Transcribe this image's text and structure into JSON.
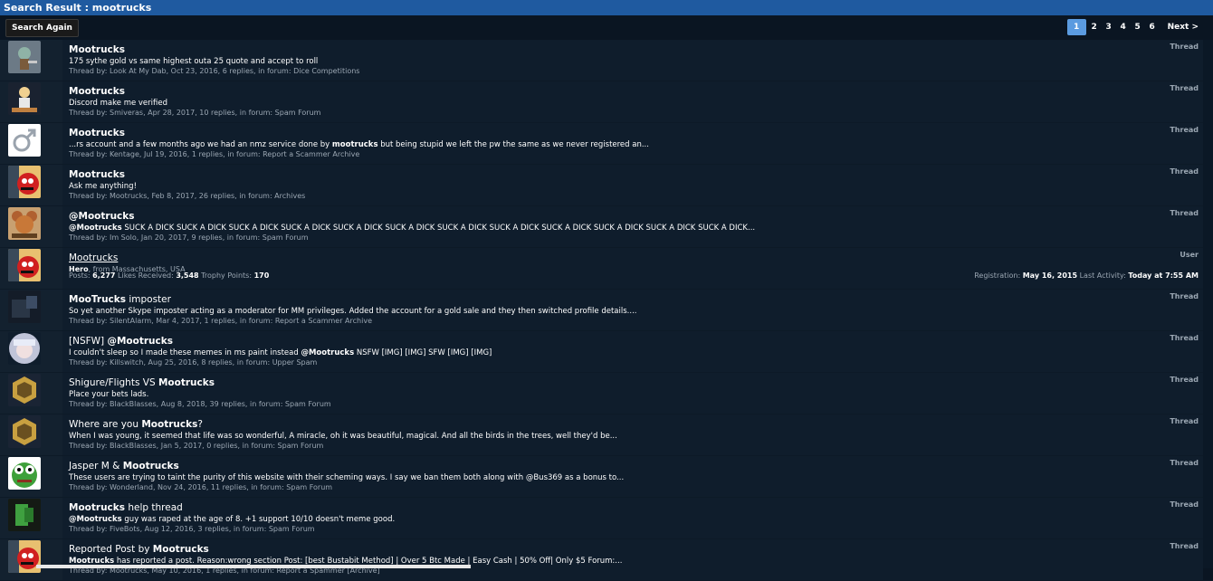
{
  "header": {
    "title": "Search Result : mootrucks"
  },
  "controls": {
    "search_again": "Search Again",
    "pages": [
      "1",
      "2",
      "3",
      "4",
      "5",
      "6"
    ],
    "next": "Next >"
  },
  "results": [
    {
      "avatar": "avatar-squidward-icon",
      "title": "Mootrucks",
      "title_bold": true,
      "snippet": "175 sythe gold vs same highest outa 25 quote and accept to roll",
      "meta": "Thread by: Look At My Dab, Oct 23, 2016, 6 replies, in forum: Dice Competitions",
      "type": "Thread"
    },
    {
      "avatar": "avatar-smiveras-icon",
      "title": "Mootrucks",
      "title_bold": true,
      "snippet": "Discord make me verified",
      "meta": "Thread by: Smiveras, Apr 28, 2017, 10 replies, in forum: Spam Forum",
      "type": "Thread"
    },
    {
      "avatar": "avatar-male-symbol-icon",
      "title": "Mootrucks",
      "title_bold": true,
      "snippet_pre": "...rs account and a few months ago we had an nmz service done by ",
      "snippet_bold": "mootrucks",
      "snippet_post": " but being stupid we left the pw the same as we never registered an...",
      "meta": "Thread by: Kentage, Jul 19, 2016, 1 replies, in forum: Report a Scammer Archive",
      "type": "Thread"
    },
    {
      "avatar": "avatar-red-cartoon-icon",
      "title": "Mootrucks",
      "title_bold": true,
      "snippet": "Ask me anything!",
      "meta": "Thread by: Mootrucks, Feb 8, 2017, 26 replies, in forum: Archives",
      "type": "Thread"
    },
    {
      "avatar": "avatar-jerry-icon",
      "title": "@Mootrucks",
      "title_bold": true,
      "snippet_bold": "@Mootrucks",
      "snippet_post": " SUCK A DICK SUCK A DICK SUCK A DICK SUCK A DICK SUCK A DICK SUCK A DICK SUCK A DICK SUCK A DICK SUCK A DICK SUCK A DICK SUCK A DICK SUCK A DICK...",
      "meta": "Thread by: Im Solo, Jan 20, 2017, 9 replies, in forum: Spam Forum",
      "type": "Thread"
    },
    {
      "user": true,
      "avatar": "avatar-red-cartoon-icon",
      "title": "Mootrucks",
      "rank": "Hero",
      "from": ", from Massachusetts, USA",
      "posts_label": "Posts: ",
      "posts": "6,277",
      "likes_label": " Likes Received: ",
      "likes": "3,548",
      "trophy_label": " Trophy Points: ",
      "trophy": "170",
      "reg_label": "Registration: ",
      "reg": "May 16, 2015",
      "act_label": " Last Activity: ",
      "act": "Today at 7:55 AM",
      "type": "User"
    },
    {
      "avatar": "avatar-dark-scene-icon",
      "title_bold_part": "MooTrucks",
      "title_rest": " imposter",
      "snippet": "So yet another Skype imposter acting as a moderator for MM privileges. Added the account for a gold sale and they then switched profile details....",
      "meta": "Thread by: SilentAlarm, Mar 4, 2017, 1 replies, in forum: Report a Scammer Archive",
      "type": "Thread"
    },
    {
      "avatar": "avatar-anime-icon",
      "title_pre": "[NSFW] ",
      "title_bold_part": "@Mootrucks",
      "snippet_pre": "I couldn't sleep so I made these memes in ms paint instead ",
      "snippet_bold": "@Mootrucks",
      "snippet_post": " NSFW [IMG] [IMG] SFW [IMG] [IMG]",
      "meta": "Thread by: Killswitch, Aug 25, 2016, 8 replies, in forum: Upper Spam",
      "type": "Thread"
    },
    {
      "avatar": "avatar-gold-badge-icon",
      "title_pre": "Shigure/Flights VS ",
      "title_bold_part": "Mootrucks",
      "snippet": "Place your bets lads.",
      "meta": "Thread by: BlackBlasses, Aug 8, 2018, 39 replies, in forum: Spam Forum",
      "type": "Thread"
    },
    {
      "avatar": "avatar-gold-badge-icon",
      "title_pre": "Where are you ",
      "title_bold_part": "Mootrucks",
      "title_rest": "?",
      "snippet": "When I was young, it seemed that life was so wonderful, A miracle, oh it was beautiful, magical. And all the birds in the trees, well they'd be...",
      "meta": "Thread by: BlackBlasses, Jan 5, 2017, 0 replies, in forum: Spam Forum",
      "type": "Thread"
    },
    {
      "avatar": "avatar-pepe-icon",
      "title_pre": "Jasper M & ",
      "title_bold_part": "Mootrucks",
      "snippet": "These users are trying to taint the purity of this website with their scheming ways. I say we ban them both along with @Bus369 as a bonus to...",
      "meta": "Thread by: Wonderland, Nov 24, 2016, 11 replies, in forum: Spam Forum",
      "type": "Thread"
    },
    {
      "avatar": "avatar-green-logo-icon",
      "title_bold_part": "Mootrucks",
      "title_rest": " help thread",
      "snippet_bold": "@Mootrucks",
      "snippet_post": " guy was raped at the age of 8. +1 support 10/10 doesn't meme good.",
      "meta": "Thread by: FiveBots, Aug 12, 2016, 3 replies, in forum: Spam Forum",
      "type": "Thread"
    },
    {
      "avatar": "avatar-red-cartoon-icon",
      "title_pre": "Reported Post by ",
      "title_bold_part": "Mootrucks",
      "snippet_bold": "Mootrucks",
      "snippet_post": " has reported a post. Reason:wrong section Post: [best Bustabit Method] | Over 5 Btc Made | Easy Cash | 50% Off| Only $5 Forum:...",
      "meta": "Thread by: Mootrucks, May 10, 2016, 1 replies, in forum: Report a Spammer [Archive]",
      "type": "Thread"
    }
  ]
}
